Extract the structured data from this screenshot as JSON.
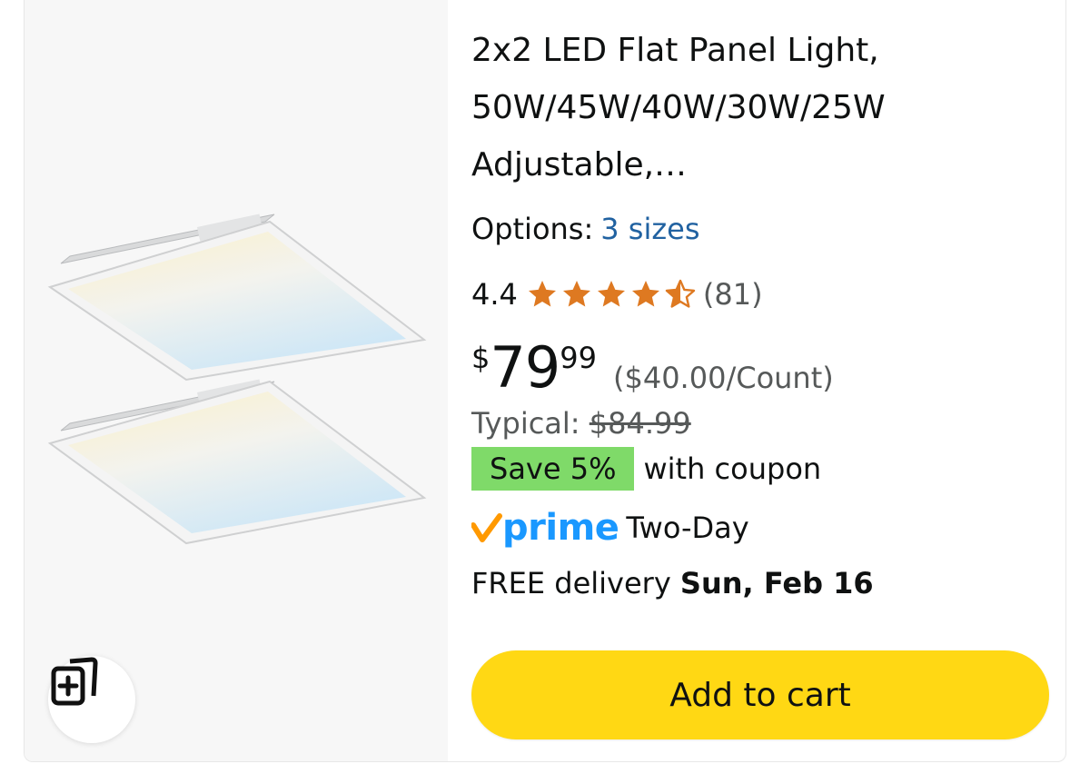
{
  "product": {
    "title": "2x2 LED Flat Panel Light, 50W/45W/40W/30W/25W Adjustable,…",
    "options_label": "Options:",
    "options_link": "3 sizes",
    "rating_value": "4.4",
    "rating_stars": 4.4,
    "rating_count": "(81)",
    "price_symbol": "$",
    "price_whole": "79",
    "price_fraction": "99",
    "unit_price": "($40.00/Count)",
    "typical_label": "Typical:",
    "typical_price": "$84.99",
    "coupon_badge": "Save 5%",
    "coupon_text": "with coupon",
    "prime_word": "prime",
    "prime_speed": "Two-Day",
    "delivery_prefix": "FREE delivery",
    "delivery_date": "Sun, Feb 16",
    "add_to_cart": "Add to cart"
  },
  "icons": {
    "compare": "add-to-compare-icon",
    "star": "star-icon",
    "prime_check": "prime-checkmark-icon"
  },
  "colors": {
    "link": "#2162a1",
    "star": "#de7921",
    "coupon_badge": "#7fda69",
    "prime": "#1a98ff",
    "prime_check": "#ff9900",
    "cart_button": "#ffd814"
  }
}
